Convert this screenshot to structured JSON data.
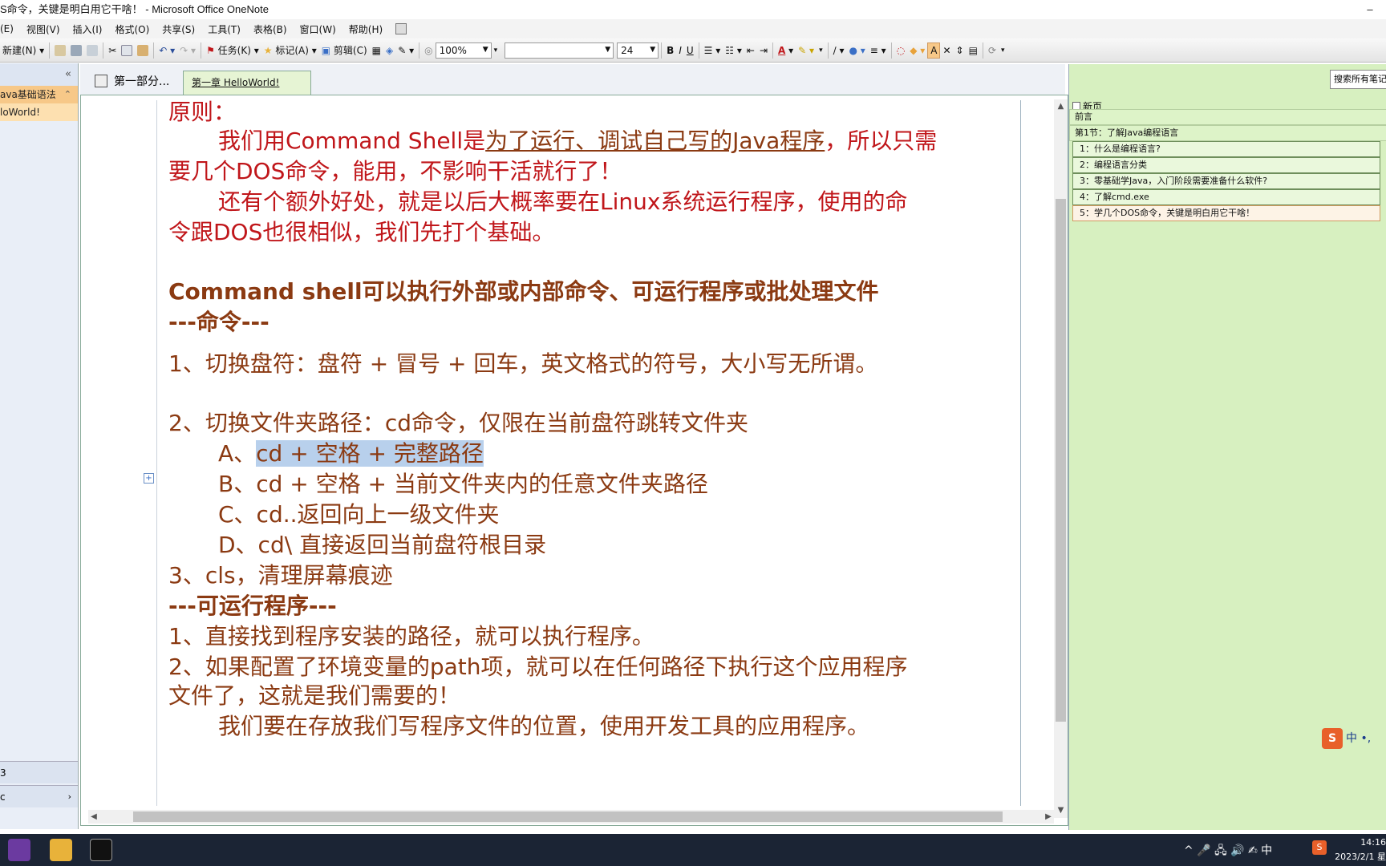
{
  "window": {
    "title": "S命令，关键是明白用它干啥！ - Microsoft Office OneNote",
    "minimize": "–"
  },
  "menu": [
    "(E)",
    "视图(V)",
    "插入(I)",
    "格式(O)",
    "共享(S)",
    "工具(T)",
    "表格(B)",
    "窗口(W)",
    "帮助(H)"
  ],
  "toolbar": {
    "new_label": "新建(N)",
    "task_label": "任务(K)",
    "tag_label": "标记(A)",
    "clip_label": "剪辑(C)",
    "zoom": "100%",
    "font_size": "24",
    "bold": "B",
    "italic": "I",
    "underline": "U",
    "font_color": "A"
  },
  "left_panel": {
    "section": "ava基础语法",
    "page": "loWorld!",
    "bottom1": "3",
    "bottom2": "c"
  },
  "tabs": {
    "tab1": "第一部分...",
    "tab2": "第一章  HelloWorld!"
  },
  "note": {
    "l01": "原则：",
    "l02a": "我们用Command Shell是",
    "l02b": "为了运行、调试自己写的Java程序",
    "l02c": "，所以只需",
    "l03": "要几个DOS命令，能用，不影响干活就行了！",
    "l04": "还有个额外好处，就是以后大概率要在Linux系统运行程序，使用的命",
    "l05": "令跟DOS也很相似，我们先打个基础。",
    "l06": "Command shell可以执行外部或内部命令、可运行程序或批处理文件",
    "l07": "---命令---",
    "l08": "1、切换盘符：盘符 + 冒号 + 回车，英文格式的符号，大小写无所谓。",
    "l09": "2、切换文件夹路径：cd命令，仅限在当前盘符跳转文件夹",
    "l10a": "A、",
    "l10b": "cd + 空格 + 完整路径 ",
    "l11": "B、cd + 空格 + 当前文件夹内的任意文件夹路径",
    "l12": "C、cd..返回向上一级文件夹",
    "l13": "D、cd\\ 直接返回当前盘符根目录",
    "l14": "3、cls，清理屏幕痕迹",
    "l15": "---可运行程序---",
    "l16": "1、直接找到程序安装的路径，就可以执行程序。",
    "l17": "2、如果配置了环境变量的path项，就可以在任何路径下执行这个应用程序",
    "l18": "文件了，这就是我们需要的！",
    "l19": "我们要在存放我们写程序文件的位置，使用开发工具的应用程序。"
  },
  "right_panel": {
    "search_placeholder": "搜索所有笔记",
    "new_page": "新页",
    "pages": [
      "前言",
      "第1节：了解Java编程语言",
      "1：什么是编程语言?",
      "2：编程语言分类",
      "3：零基础学Java，入门阶段需要准备什么软件?",
      "4：了解cmd.exe",
      "5：学几个DOS命令，关键是明白用它干啥！"
    ],
    "ime": "中 •,"
  },
  "taskbar": {
    "tray": "^  🎤  🖧  🔊  ✍  中",
    "time": "14:16",
    "date": "2023/2/1 星"
  },
  "colors": {
    "note_red": "#c0161a",
    "note_brown": "#8b3a12",
    "highlight": "#b8d0ec",
    "right_panel_bg": "#d7f0c0"
  }
}
